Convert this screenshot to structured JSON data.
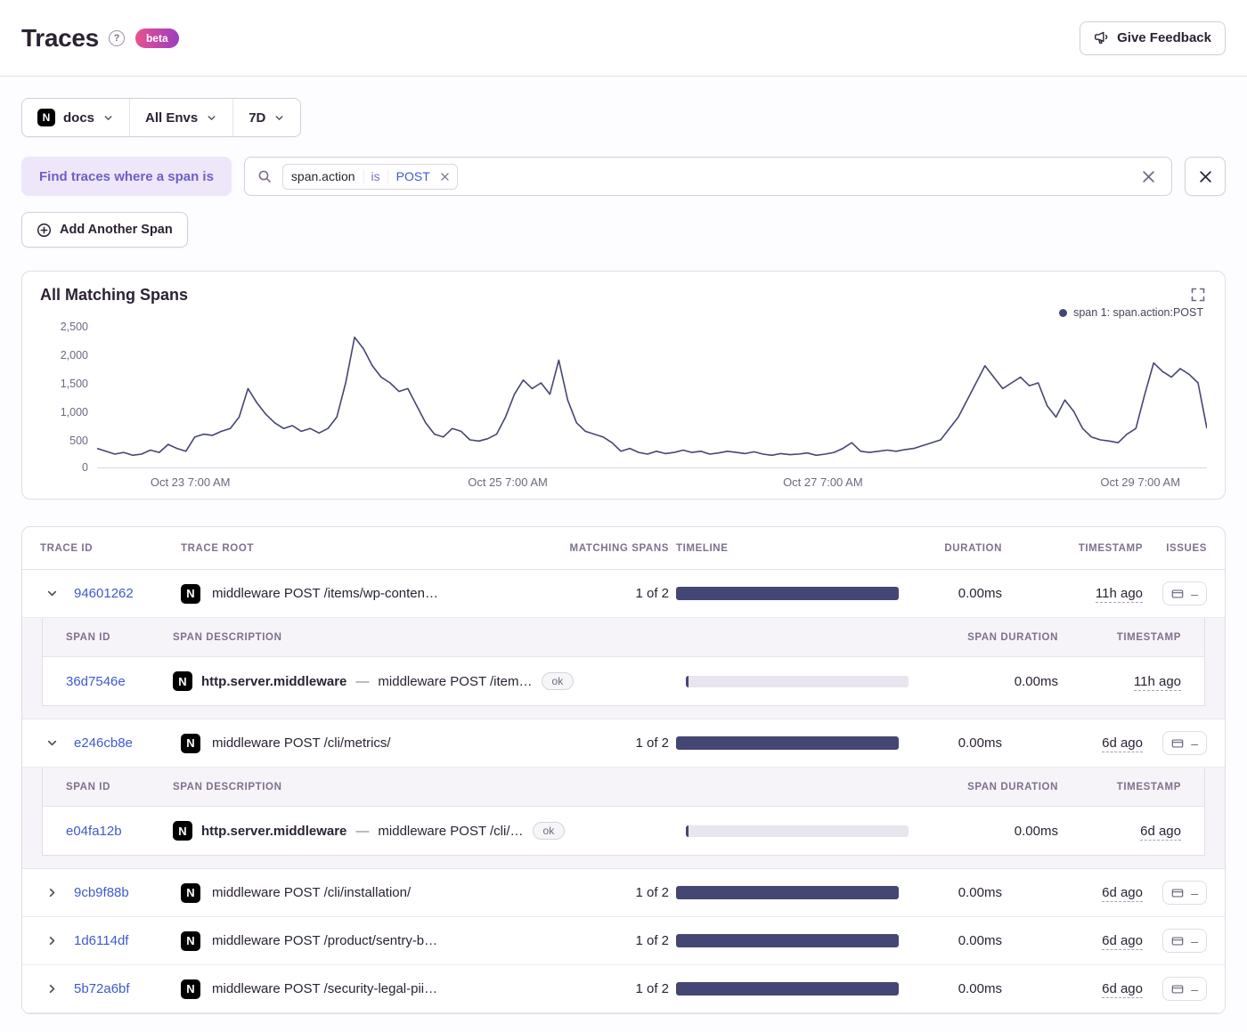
{
  "icons": {
    "nextjs": "N",
    "help": "?"
  },
  "colors": {
    "chart_line": "#444674",
    "timeline_bar": "#444674",
    "link_blue": "#4059d0",
    "accent_purple": "#6e5fc7",
    "beta_gradient_from": "#e8538c",
    "beta_gradient_to": "#9d3cc0"
  },
  "header": {
    "title": "Traces",
    "beta_badge": "beta",
    "feedback_button": "Give Feedback"
  },
  "filters": {
    "project_label": "docs",
    "env_label": "All Envs",
    "period_label": "7D"
  },
  "search": {
    "where_pill": "Find traces where a span is",
    "token_key": "span.action",
    "token_op": "is",
    "token_value": "POST",
    "add_span_button": "Add Another Span"
  },
  "chart_data": {
    "type": "line",
    "title": "All Matching Spans",
    "legend": "span 1: span.action:POST",
    "legend_position": "top-right",
    "grid": false,
    "ylim": [
      0,
      2500
    ],
    "y_ticks": [
      "2,500",
      "2,000",
      "1,500",
      "1,000",
      "500",
      "0"
    ],
    "x_ticks": [
      "Oct 23 7:00 AM",
      "Oct 25 7:00 AM",
      "Oct 27 7:00 AM",
      "Oct 29 7:00 AM"
    ],
    "series": [
      {
        "name": "span 1: span.action:POST",
        "color": "#444674",
        "values": [
          350,
          300,
          250,
          280,
          230,
          250,
          320,
          280,
          420,
          350,
          300,
          550,
          600,
          580,
          650,
          700,
          900,
          1400,
          1150,
          950,
          800,
          700,
          750,
          650,
          700,
          620,
          700,
          900,
          1500,
          2300,
          2100,
          1800,
          1600,
          1500,
          1350,
          1400,
          1100,
          800,
          600,
          550,
          700,
          650,
          500,
          480,
          520,
          600,
          900,
          1300,
          1550,
          1400,
          1500,
          1300,
          1900,
          1200,
          800,
          650,
          600,
          550,
          450,
          300,
          350,
          280,
          250,
          300,
          260,
          280,
          320,
          280,
          300,
          250,
          270,
          300,
          280,
          260,
          290,
          250,
          230,
          260,
          240,
          250,
          270,
          230,
          250,
          280,
          350,
          450,
          300,
          280,
          300,
          320,
          300,
          330,
          350,
          400,
          450,
          500,
          700,
          900,
          1200,
          1500,
          1800,
          1600,
          1400,
          1500,
          1600,
          1450,
          1500,
          1100,
          900,
          1200,
          1000,
          700,
          550,
          500,
          480,
          450,
          600,
          700,
          1300,
          1850,
          1700,
          1600,
          1750,
          1650,
          1500,
          700
        ]
      }
    ]
  },
  "table": {
    "columns": [
      "TRACE ID",
      "TRACE ROOT",
      "MATCHING SPANS",
      "TIMELINE",
      "DURATION",
      "TIMESTAMP",
      "ISSUES"
    ],
    "span_columns": [
      "SPAN ID",
      "SPAN DESCRIPTION",
      "SPAN DURATION",
      "TIMESTAMP"
    ],
    "issues_empty": "–",
    "rows": [
      {
        "trace_id": "94601262",
        "trace_root": "middleware POST /items/wp-conten…",
        "matching_spans": "1 of 2",
        "duration": "0.00ms",
        "timestamp": "11h ago",
        "expanded": true,
        "spans": [
          {
            "span_id": "36d7546e",
            "op": "http.server.middleware",
            "sep": "—",
            "description": "middleware POST /item…",
            "status": "ok",
            "duration": "0.00ms",
            "timestamp": "11h ago"
          }
        ]
      },
      {
        "trace_id": "e246cb8e",
        "trace_root": "middleware POST /cli/metrics/",
        "matching_spans": "1 of 2",
        "duration": "0.00ms",
        "timestamp": "6d ago",
        "expanded": true,
        "spans": [
          {
            "span_id": "e04fa12b",
            "op": "http.server.middleware",
            "sep": "—",
            "description": "middleware POST /cli/…",
            "status": "ok",
            "duration": "0.00ms",
            "timestamp": "6d ago"
          }
        ]
      },
      {
        "trace_id": "9cb9f88b",
        "trace_root": "middleware POST /cli/installation/",
        "matching_spans": "1 of 2",
        "duration": "0.00ms",
        "timestamp": "6d ago",
        "expanded": false
      },
      {
        "trace_id": "1d6114df",
        "trace_root": "middleware POST /product/sentry-b…",
        "matching_spans": "1 of 2",
        "duration": "0.00ms",
        "timestamp": "6d ago",
        "expanded": false
      },
      {
        "trace_id": "5b72a6bf",
        "trace_root": "middleware POST /security-legal-pii…",
        "matching_spans": "1 of 2",
        "duration": "0.00ms",
        "timestamp": "6d ago",
        "expanded": false
      }
    ]
  }
}
